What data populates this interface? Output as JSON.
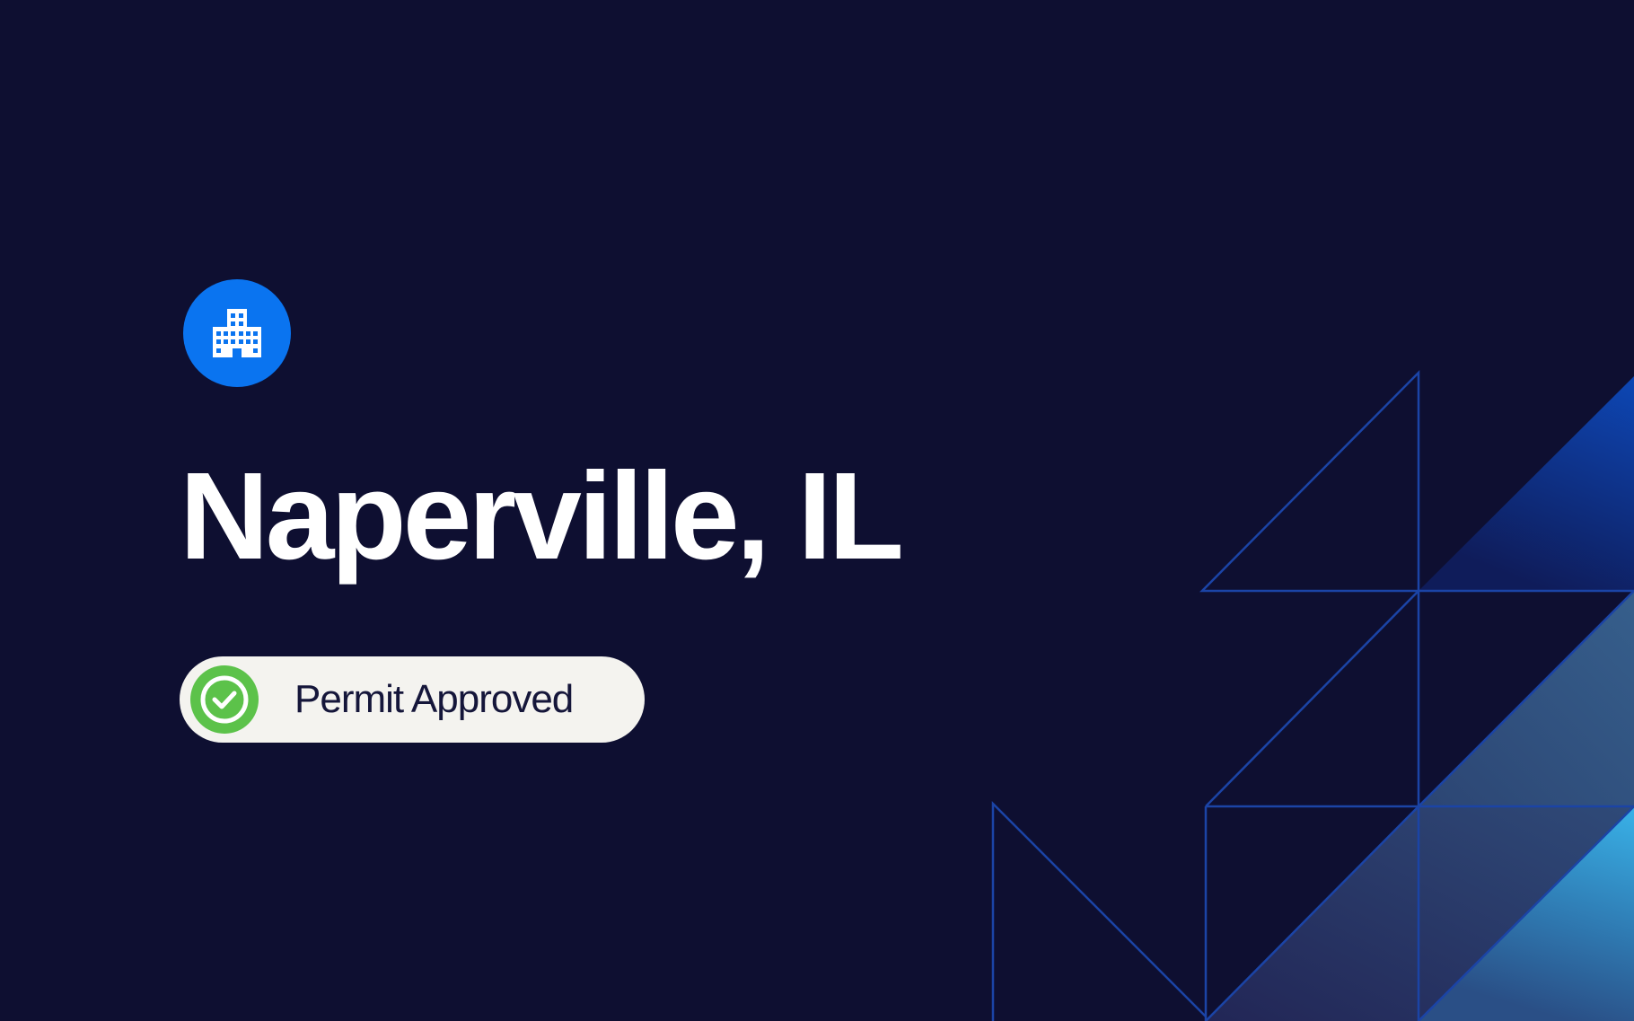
{
  "page": {
    "title": "Naperville, IL",
    "icon": "building-icon"
  },
  "status": {
    "label": "Permit Approved",
    "icon": "check-circle-icon",
    "color": "#5cc24a"
  },
  "colors": {
    "background": "#0e0f31",
    "accent": "#0a74f0",
    "pill_background": "#f4f3ef",
    "line": "#1b44a6"
  }
}
